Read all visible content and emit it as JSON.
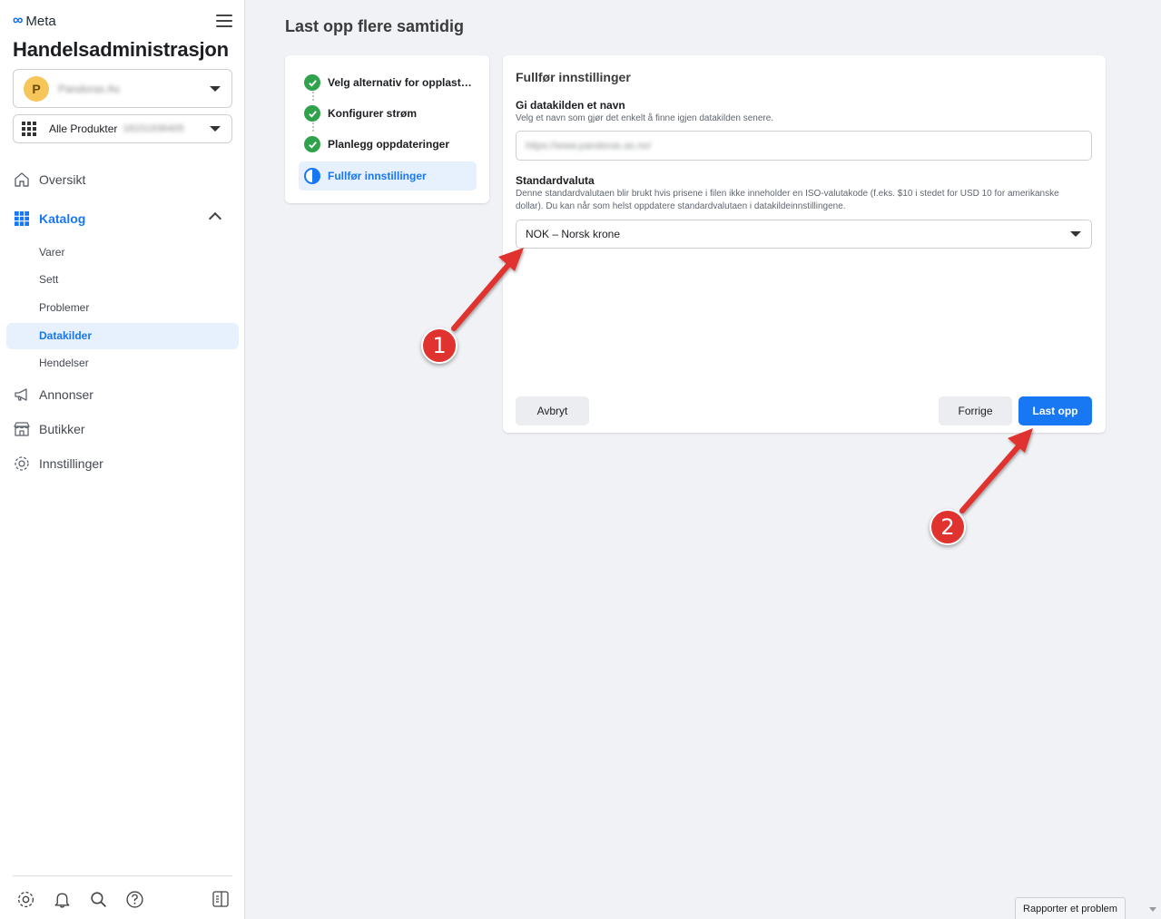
{
  "sidebar": {
    "brand": "Meta",
    "app_title": "Handelsadministrasjon",
    "account": {
      "avatar_letter": "P",
      "name": "Pandoras As"
    },
    "catalog": {
      "label": "Alle Produkter",
      "id": "18151936405"
    },
    "nav": {
      "overview": "Oversikt",
      "catalog": "Katalog",
      "sub": [
        "Varer",
        "Sett",
        "Problemer",
        "Datakilder",
        "Hendelser"
      ],
      "ads": "Annonser",
      "shops": "Butikker",
      "settings": "Innstillinger"
    }
  },
  "main": {
    "page_title": "Last opp flere samtidig",
    "steps": [
      {
        "label": "Velg alternativ for opplast…",
        "status": "done"
      },
      {
        "label": "Konfigurer strøm",
        "status": "done"
      },
      {
        "label": "Planlegg oppdateringer",
        "status": "done"
      },
      {
        "label": "Fullfør innstillinger",
        "status": "current"
      }
    ],
    "form": {
      "title": "Fullfør innstillinger",
      "name_label": "Gi datakilden et navn",
      "name_help": "Velg et navn som gjør det enkelt å finne igjen datakilden senere.",
      "name_value": "https://www.pandoras.as.no/",
      "currency_label": "Standardvaluta",
      "currency_help": "Denne standardvalutaen blir brukt hvis prisene i filen ikke inneholder en ISO-valutakode (f.eks. $10 i stedet for USD 10 for amerikanske dollar). Du kan når som helst oppdatere standardvalutaen i datakildeinnstillingene.",
      "currency_value": "NOK – Norsk krone",
      "cancel": "Avbryt",
      "previous": "Forrige",
      "upload": "Last opp"
    }
  },
  "annotations": {
    "badge1": "1",
    "badge2": "2"
  },
  "footer": {
    "report": "Rapporter et problem"
  },
  "colors": {
    "accent": "#1877f2",
    "success": "#31a24c",
    "annotation": "#e0322f"
  }
}
